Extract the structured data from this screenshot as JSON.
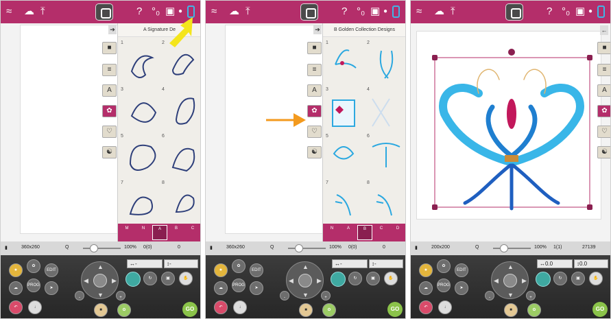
{
  "screens": [
    {
      "panel_title": "A Signature De",
      "category_tabs": [
        "M",
        "N",
        "A",
        "B",
        "C"
      ],
      "cell_numbers": [
        "1",
        "2",
        "3",
        "4",
        "5",
        "6",
        "7",
        "8"
      ],
      "status": {
        "hoop": "360x260",
        "zoom": "100%",
        "count": "0(0)",
        "stitches": "0"
      },
      "fields": {
        "f1": "↔-",
        "f2": "↕-"
      }
    },
    {
      "panel_title": "B Golden Collection Designs",
      "category_tabs": [
        "N",
        "A",
        "B",
        "C",
        "D"
      ],
      "cell_numbers": [
        "1",
        "2",
        "3",
        "4",
        "5",
        "6",
        "7",
        "8"
      ],
      "status": {
        "hoop": "360x260",
        "zoom": "100%",
        "count": "0(0)",
        "stitches": "0"
      },
      "fields": {
        "f1": "↔-",
        "f2": "↕-"
      }
    },
    {
      "status": {
        "hoop": "200x200",
        "zoom": "100%",
        "count": "1(1)",
        "stitches": "27139"
      },
      "fields": {
        "f1": "↔0.0",
        "f2": "↕0.0"
      }
    }
  ],
  "common": {
    "edit_label": "EDIT",
    "prog_label": "PROG",
    "go_label": "GO"
  },
  "colors": {
    "brand": "#b42e6a",
    "accent": "#3fb6e6",
    "go": "#8bc34a"
  }
}
